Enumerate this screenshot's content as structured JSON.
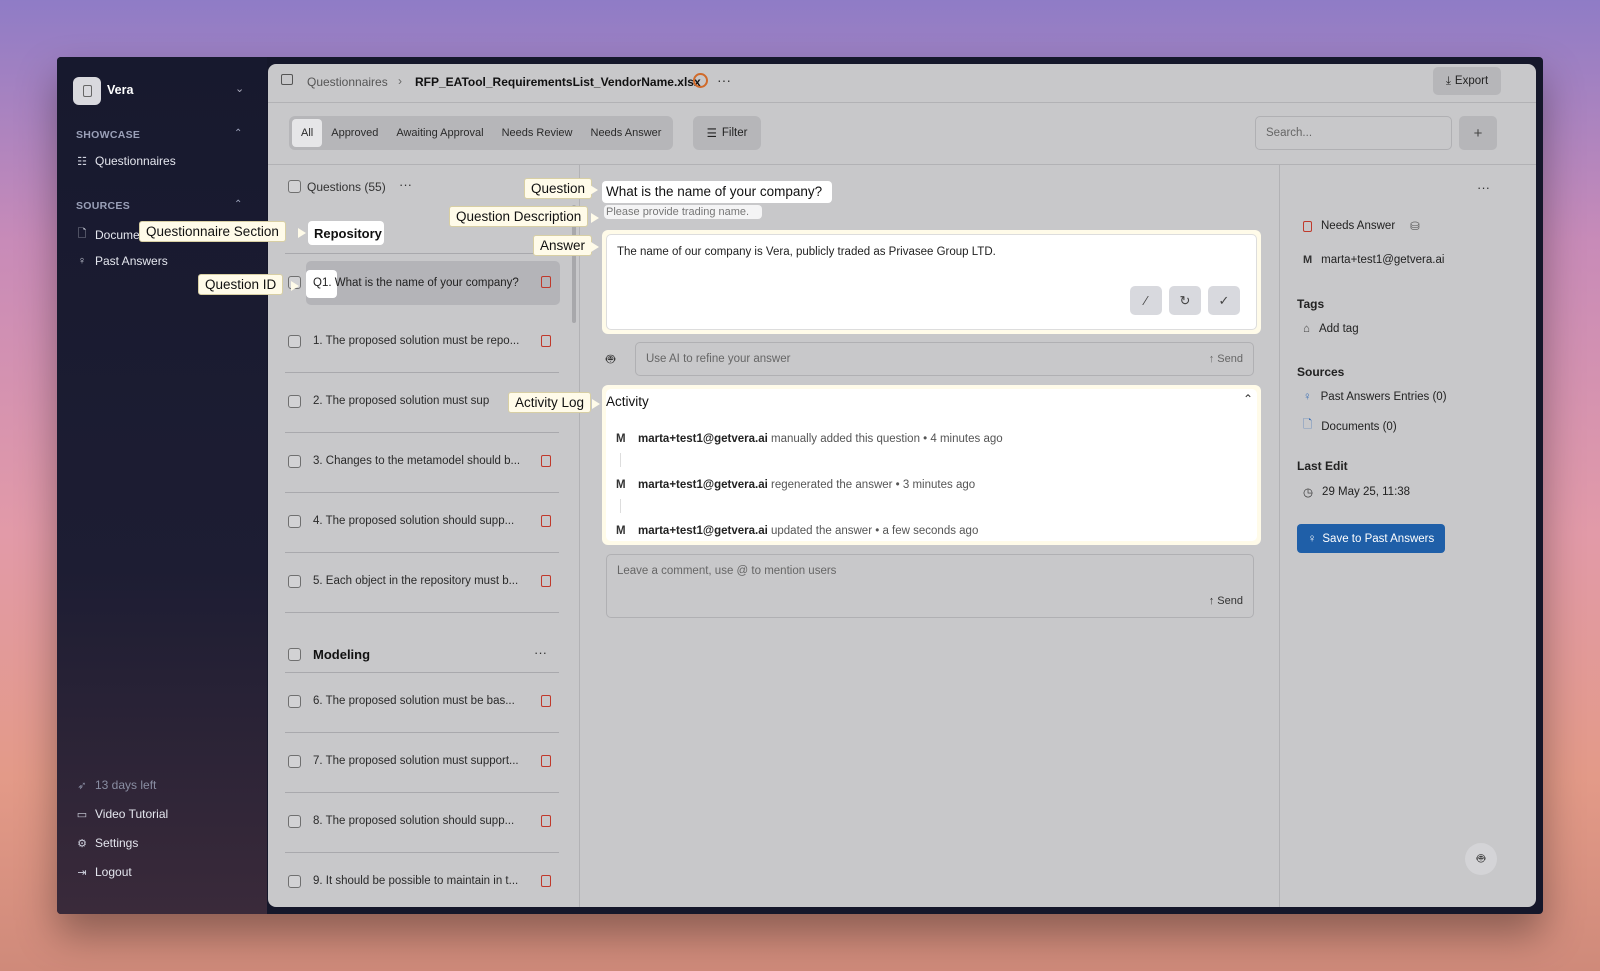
{
  "workspace": {
    "name": "Vera"
  },
  "sidebar": {
    "showcase_heading": "SHOWCASE",
    "questionnaires": "Questionnaires",
    "sources_heading": "SOURCES",
    "documents": "Docume",
    "past_answers": "Past Answers",
    "trial": "13 days left",
    "video": "Video Tutorial",
    "settings": "Settings",
    "logout": "Logout"
  },
  "header": {
    "breadcrumb_root": "Questionnaires",
    "file": "RFP_EATool_RequirementsList_VendorName.xlsx",
    "export": "Export"
  },
  "filters": {
    "tabs": [
      "All",
      "Approved",
      "Awaiting Approval",
      "Needs Review",
      "Needs Answer"
    ],
    "filter": "Filter",
    "search_placeholder": "Search...",
    "add": "+"
  },
  "list": {
    "header": "Questions (55)",
    "section1": "Repository",
    "q1": "Q1. What is the name of your company?",
    "items": [
      "1. The proposed solution must be repo...",
      "2. The proposed solution must sup",
      "3. Changes to the metamodel should b...",
      "4. The proposed solution should supp...",
      "5. Each object in the repository must b..."
    ],
    "section2": "Modeling",
    "items2": [
      "6. The proposed solution must be bas...",
      "7. The proposed solution must support...",
      "8. The proposed solution should supp...",
      "9. It should be possible to maintain in t..."
    ]
  },
  "detail": {
    "question": "What is the name of your company?",
    "description": "Please provide trading name.",
    "answer": "The name of our company is Vera, publicly traded as Privasee Group LTD.",
    "ai_placeholder": "Use AI to refine your answer",
    "send": "Send",
    "activity_title": "Activity",
    "activity": [
      {
        "avatar": "M",
        "user": "marta+test1@getvera.ai",
        "action": "manually added this question",
        "time": "4 minutes ago"
      },
      {
        "avatar": "M",
        "user": "marta+test1@getvera.ai",
        "action": "regenerated the answer",
        "time": "3 minutes ago"
      },
      {
        "avatar": "M",
        "user": "marta+test1@getvera.ai",
        "action": "updated the answer",
        "time": "a few seconds ago"
      }
    ],
    "comment_placeholder": "Leave a comment, use @ to mention users"
  },
  "callouts": {
    "question": "Question",
    "description": "Question Description",
    "answer": "Answer",
    "section": "Questionnaire Section",
    "qid": "Question ID",
    "activity": "Activity Log"
  },
  "right": {
    "status": "Needs Answer",
    "assignee_avatar": "M",
    "assignee": "marta+test1@getvera.ai",
    "tags": "Tags",
    "add_tag": "Add tag",
    "sources": "Sources",
    "past_entries": "Past Answers Entries (0)",
    "documents": "Documents (0)",
    "last_edit": "Last Edit",
    "date": "29 May 25, 11:38",
    "save": "Save to Past Answers"
  }
}
